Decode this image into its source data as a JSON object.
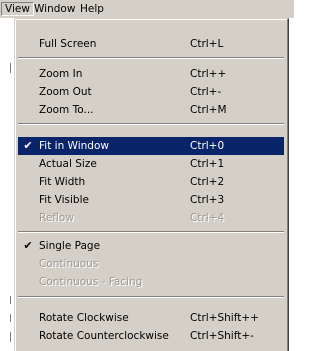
{
  "menubar": {
    "items": [
      "View",
      "Window",
      "Help"
    ]
  },
  "menu": {
    "items": [
      {
        "label": "Full Screen",
        "shortcut": "Ctrl+L"
      },
      {
        "label": "Zoom In",
        "shortcut": "Ctrl++"
      },
      {
        "label": "Zoom Out",
        "shortcut": "Ctrl+-"
      },
      {
        "label": "Zoom To...",
        "shortcut": "Ctrl+M"
      },
      {
        "label": "Fit in Window",
        "shortcut": "Ctrl+0",
        "checked": true,
        "highlighted": true
      },
      {
        "label": "Actual Size",
        "shortcut": "Ctrl+1"
      },
      {
        "label": "Fit Width",
        "shortcut": "Ctrl+2"
      },
      {
        "label": "Fit Visible",
        "shortcut": "Ctrl+3"
      },
      {
        "label": "Reflow",
        "shortcut": "Ctrl+4",
        "disabled": true
      },
      {
        "label": "Single Page",
        "shortcut": "",
        "checked": true
      },
      {
        "label": "Continuous",
        "shortcut": "",
        "disabled": true
      },
      {
        "label": "Continuous - Facing",
        "shortcut": "",
        "disabled": true
      },
      {
        "label": "Rotate Clockwise",
        "shortcut": "Ctrl+Shift++"
      },
      {
        "label": "Rotate Counterclockwise",
        "shortcut": "Ctrl+Shift+-"
      }
    ],
    "check_glyph": "✔"
  },
  "colors": {
    "menu_bg": "#d4d0c8",
    "highlight_bg": "#0a246a",
    "highlight_fg": "#ffffff",
    "disabled_fg": "#9c9a94"
  }
}
